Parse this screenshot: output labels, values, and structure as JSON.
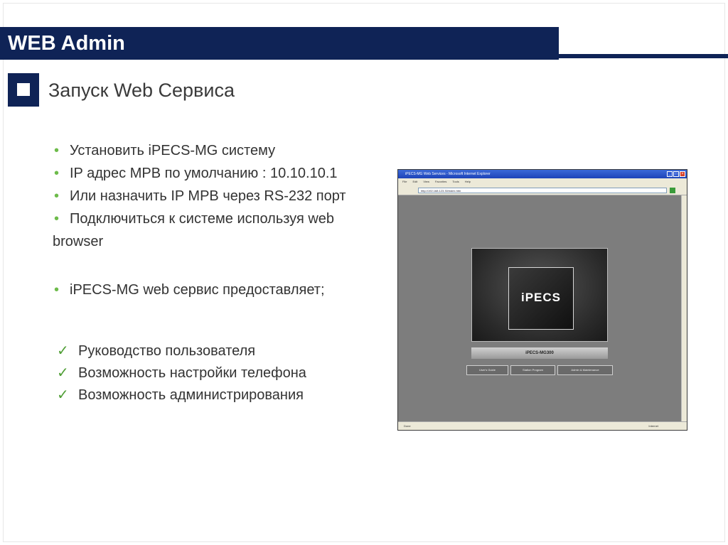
{
  "title": "WEB Admin",
  "section": {
    "heading": "Запуск Web Сервиса"
  },
  "bullets": [
    "Установить iPECS-MG систему",
    "IP адрес MPB по умолчанию : 10.10.10.1",
    "Или назначить IP MPB через RS-232 порт",
    "Подключиться к системе используя web",
    "browser",
    "iPECS-MG web сервис предоставляет;"
  ],
  "checks": [
    "Руководство пользователя",
    "Возможность настройки телефона",
    "Возможность администрирования"
  ],
  "browser": {
    "window_title": "iPECS-MG Web Services - Microsoft Internet Explorer",
    "menu": [
      "File",
      "Edit",
      "View",
      "Favorites",
      "Tools",
      "Help"
    ],
    "address": "http://192.168.123.30/index.htm",
    "logo": "iPECS",
    "model": "iPECS-MG300",
    "buttons": [
      "User's Guide",
      "Station Program",
      "Admin & Maintenance"
    ],
    "status_left": "Done",
    "status_right": "Internet"
  },
  "colors": {
    "brand": "#0f2356",
    "bullet": "#6dbb4a",
    "check": "#4f9e35"
  }
}
